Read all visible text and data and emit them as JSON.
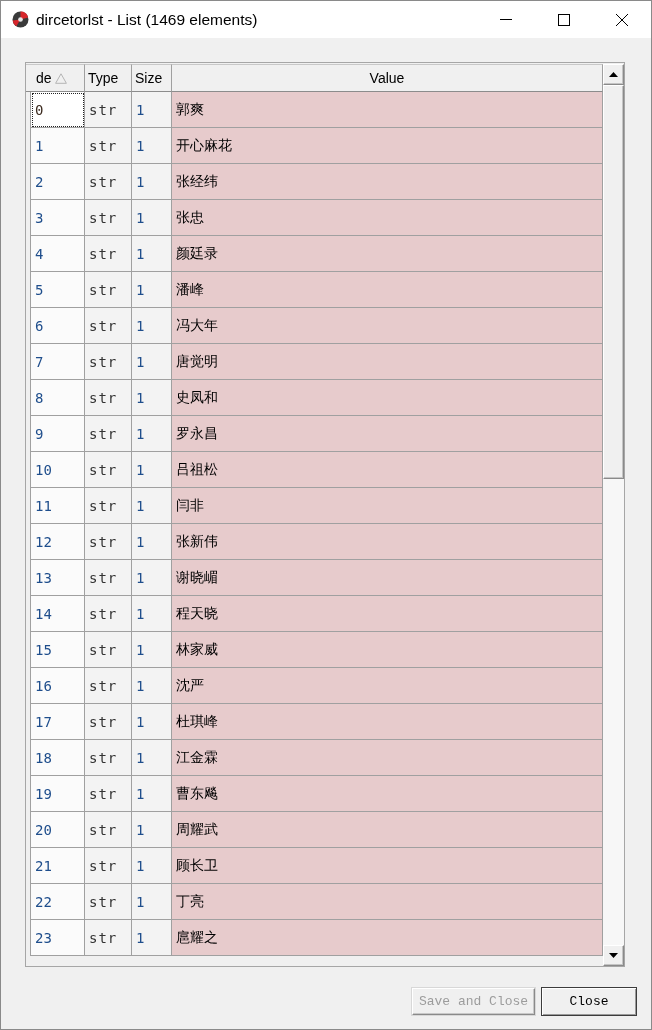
{
  "window": {
    "title": "dircetorlst - List (1469 elements)"
  },
  "table": {
    "columns": [
      {
        "label": "de",
        "sorted": true
      },
      {
        "label": "Type",
        "sorted": false
      },
      {
        "label": "Size",
        "sorted": false
      },
      {
        "label": "Value",
        "sorted": false
      }
    ],
    "rows": [
      {
        "index": "0",
        "type": "str",
        "size": "1",
        "value": "郭爽",
        "focused": true
      },
      {
        "index": "1",
        "type": "str",
        "size": "1",
        "value": "开心麻花",
        "focused": false
      },
      {
        "index": "2",
        "type": "str",
        "size": "1",
        "value": "张经纬",
        "focused": false
      },
      {
        "index": "3",
        "type": "str",
        "size": "1",
        "value": "张忠",
        "focused": false
      },
      {
        "index": "4",
        "type": "str",
        "size": "1",
        "value": "颜廷录",
        "focused": false
      },
      {
        "index": "5",
        "type": "str",
        "size": "1",
        "value": "潘峰",
        "focused": false
      },
      {
        "index": "6",
        "type": "str",
        "size": "1",
        "value": "冯大年",
        "focused": false
      },
      {
        "index": "7",
        "type": "str",
        "size": "1",
        "value": "唐觉明",
        "focused": false
      },
      {
        "index": "8",
        "type": "str",
        "size": "1",
        "value": "史凤和",
        "focused": false
      },
      {
        "index": "9",
        "type": "str",
        "size": "1",
        "value": "罗永昌",
        "focused": false
      },
      {
        "index": "10",
        "type": "str",
        "size": "1",
        "value": "吕祖松",
        "focused": false
      },
      {
        "index": "11",
        "type": "str",
        "size": "1",
        "value": "闫非",
        "focused": false
      },
      {
        "index": "12",
        "type": "str",
        "size": "1",
        "value": "张新伟",
        "focused": false
      },
      {
        "index": "13",
        "type": "str",
        "size": "1",
        "value": "谢晓嵋",
        "focused": false
      },
      {
        "index": "14",
        "type": "str",
        "size": "1",
        "value": "程天晓",
        "focused": false
      },
      {
        "index": "15",
        "type": "str",
        "size": "1",
        "value": "林家威",
        "focused": false
      },
      {
        "index": "16",
        "type": "str",
        "size": "1",
        "value": "沈严",
        "focused": false
      },
      {
        "index": "17",
        "type": "str",
        "size": "1",
        "value": "杜琪峰",
        "focused": false
      },
      {
        "index": "18",
        "type": "str",
        "size": "1",
        "value": "江金霖",
        "focused": false
      },
      {
        "index": "19",
        "type": "str",
        "size": "1",
        "value": "曹东飚",
        "focused": false
      },
      {
        "index": "20",
        "type": "str",
        "size": "1",
        "value": "周耀武",
        "focused": false
      },
      {
        "index": "21",
        "type": "str",
        "size": "1",
        "value": "顾长卫",
        "focused": false
      },
      {
        "index": "22",
        "type": "str",
        "size": "1",
        "value": "丁亮",
        "focused": false
      },
      {
        "index": "23",
        "type": "str",
        "size": "1",
        "value": "扈耀之",
        "focused": false
      }
    ]
  },
  "buttons": [
    {
      "label": "Save and Close",
      "disabled": true
    },
    {
      "label": "Close",
      "disabled": false
    }
  ]
}
